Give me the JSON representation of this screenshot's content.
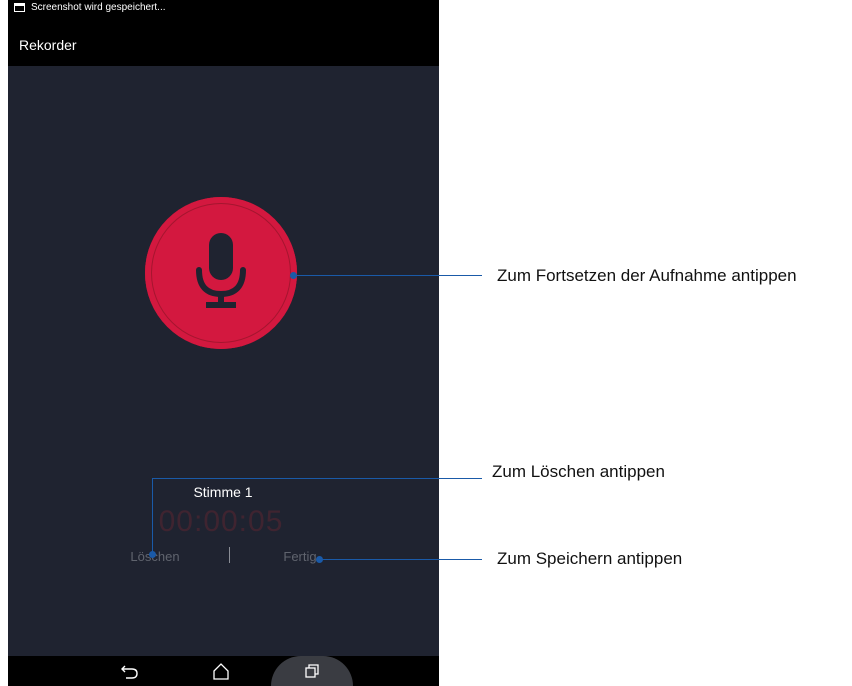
{
  "status_bar": {
    "notification": "Screenshot wird gespeichert..."
  },
  "app": {
    "title": "Rekorder"
  },
  "recorder": {
    "recording_name": "Stimme 1",
    "time": "00:00:05",
    "delete_label": "Löschen",
    "separator": "|",
    "done_label": "Fertig"
  },
  "callouts": {
    "resume": "Zum Fortsetzen der Aufnahme antippen",
    "delete": "Zum Löschen antippen",
    "save": "Zum Speichern antippen"
  },
  "colors": {
    "background": "#1f2330",
    "mic_button": "#d3183f",
    "callout_line": "#1a5aa8"
  },
  "icons": [
    "screenshot-icon",
    "microphone-icon",
    "back-icon",
    "home-icon",
    "recent-apps-icon"
  ]
}
